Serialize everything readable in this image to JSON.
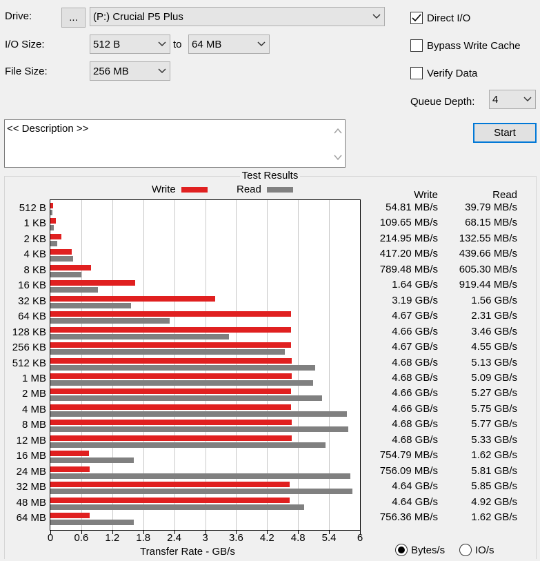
{
  "controls": {
    "drive_label": "Drive:",
    "browse_label": "...",
    "drive_value": "(P:) Crucial P5 Plus",
    "io_size_label": "I/O Size:",
    "io_from": "512 B",
    "to_label": "to",
    "io_to": "64 MB",
    "file_size_label": "File Size:",
    "file_size": "256 MB",
    "direct_io": {
      "label": "Direct I/O",
      "checked": true
    },
    "bypass_cache": {
      "label": "Bypass Write Cache",
      "checked": false
    },
    "verify_data": {
      "label": "Verify Data",
      "checked": false
    },
    "queue_depth_label": "Queue Depth:",
    "queue_depth": "4",
    "start_label": "Start",
    "description": "<< Description >>"
  },
  "results": {
    "title": "Test Results",
    "write_header": "Write",
    "read_header": "Read",
    "rows": [
      {
        "size": "512 B",
        "write": "54.81 MB/s",
        "read": "39.79 MB/s"
      },
      {
        "size": "1 KB",
        "write": "109.65 MB/s",
        "read": "68.15 MB/s"
      },
      {
        "size": "2 KB",
        "write": "214.95 MB/s",
        "read": "132.55 MB/s"
      },
      {
        "size": "4 KB",
        "write": "417.20 MB/s",
        "read": "439.66 MB/s"
      },
      {
        "size": "8 KB",
        "write": "789.48 MB/s",
        "read": "605.30 MB/s"
      },
      {
        "size": "16 KB",
        "write": "1.64 GB/s",
        "read": "919.44 MB/s"
      },
      {
        "size": "32 KB",
        "write": "3.19 GB/s",
        "read": "1.56 GB/s"
      },
      {
        "size": "64 KB",
        "write": "4.67 GB/s",
        "read": "2.31 GB/s"
      },
      {
        "size": "128 KB",
        "write": "4.66 GB/s",
        "read": "3.46 GB/s"
      },
      {
        "size": "256 KB",
        "write": "4.67 GB/s",
        "read": "4.55 GB/s"
      },
      {
        "size": "512 KB",
        "write": "4.68 GB/s",
        "read": "5.13 GB/s"
      },
      {
        "size": "1 MB",
        "write": "4.68 GB/s",
        "read": "5.09 GB/s"
      },
      {
        "size": "2 MB",
        "write": "4.66 GB/s",
        "read": "5.27 GB/s"
      },
      {
        "size": "4 MB",
        "write": "4.66 GB/s",
        "read": "5.75 GB/s"
      },
      {
        "size": "8 MB",
        "write": "4.68 GB/s",
        "read": "5.77 GB/s"
      },
      {
        "size": "12 MB",
        "write": "4.68 GB/s",
        "read": "5.33 GB/s"
      },
      {
        "size": "16 MB",
        "write": "754.79 MB/s",
        "read": "1.62 GB/s"
      },
      {
        "size": "24 MB",
        "write": "756.09 MB/s",
        "read": "5.81 GB/s"
      },
      {
        "size": "32 MB",
        "write": "4.64 GB/s",
        "read": "5.85 GB/s"
      },
      {
        "size": "48 MB",
        "write": "4.64 GB/s",
        "read": "4.92 GB/s"
      },
      {
        "size": "64 MB",
        "write": "756.36 MB/s",
        "read": "1.62 GB/s"
      }
    ],
    "units": {
      "bytes": "Bytes/s",
      "io": "IO/s",
      "selected": "bytes"
    }
  },
  "chart_data": {
    "type": "bar",
    "orientation": "horizontal",
    "categories": [
      "512 B",
      "1 KB",
      "2 KB",
      "4 KB",
      "8 KB",
      "16 KB",
      "32 KB",
      "64 KB",
      "128 KB",
      "256 KB",
      "512 KB",
      "1 MB",
      "2 MB",
      "4 MB",
      "8 MB",
      "12 MB",
      "16 MB",
      "24 MB",
      "32 MB",
      "48 MB",
      "64 MB"
    ],
    "series": [
      {
        "name": "Write",
        "color": "#e02020",
        "values": [
          0.05481,
          0.10965,
          0.21495,
          0.4172,
          0.78948,
          1.64,
          3.19,
          4.67,
          4.66,
          4.67,
          4.68,
          4.68,
          4.66,
          4.66,
          4.68,
          4.68,
          0.75479,
          0.75609,
          4.64,
          4.64,
          0.75636
        ]
      },
      {
        "name": "Read",
        "color": "#808080",
        "values": [
          0.03979,
          0.06815,
          0.13255,
          0.43966,
          0.6053,
          0.91944,
          1.56,
          2.31,
          3.46,
          4.55,
          5.13,
          5.09,
          5.27,
          5.75,
          5.77,
          5.33,
          1.62,
          5.81,
          5.85,
          4.92,
          1.62
        ]
      }
    ],
    "xlabel": "Transfer Rate - GB/s",
    "xlim": [
      0,
      6
    ],
    "xticks": [
      "0",
      "0.6",
      "1.2",
      "1.8",
      "2.4",
      "3",
      "3.6",
      "4.2",
      "4.8",
      "5.4",
      "6"
    ],
    "grid": true,
    "legend": "top"
  }
}
